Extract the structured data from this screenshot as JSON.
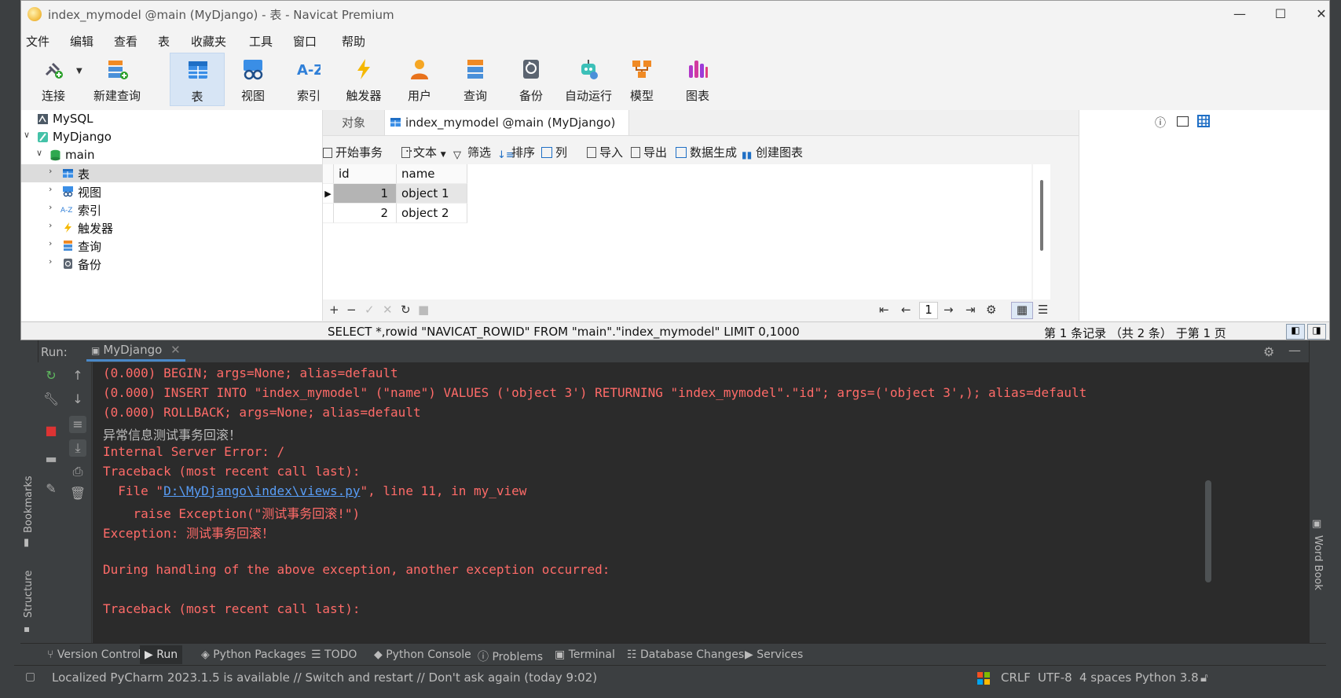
{
  "navicat": {
    "window_title": "index_mymodel @main (MyDjango) - 表 - Navicat Premium",
    "window_controls": {
      "minimize": "—",
      "maximize": "☐",
      "close": "✕"
    },
    "menu": [
      "文件",
      "编辑",
      "查看",
      "表",
      "收藏夹",
      "工具",
      "窗口",
      "帮助"
    ],
    "toolbar": [
      "连接",
      "新建查询",
      "表",
      "视图",
      "索引",
      "触发器",
      "用户",
      "查询",
      "备份",
      "自动运行",
      "模型",
      "图表"
    ],
    "toolbar_active": "表",
    "tree": {
      "conn1": "MySQL",
      "conn2": "MyDjango",
      "db": "main",
      "items": [
        "表",
        "视图",
        "索引",
        "触发器",
        "查询",
        "备份"
      ]
    },
    "tabs": {
      "objects": "对象",
      "active": "index_mymodel @main (MyDjango) ..."
    },
    "grid_toolbar": [
      "开始事务",
      "文本",
      "筛选",
      "排序",
      "列",
      "导入",
      "导出",
      "数据生成",
      "创建图表"
    ],
    "table": {
      "columns": [
        "id",
        "name"
      ],
      "rows": [
        [
          "1",
          "object 1"
        ],
        [
          "2",
          "object 2"
        ]
      ]
    },
    "pager": {
      "page": "1"
    },
    "sql": "SELECT *,rowid \"NAVICAT_ROWID\" FROM \"main\".\"index_mymodel\" LIMIT 0,1000",
    "record_info": "第 1 条记录 （共 2 条） 于第 1 页"
  },
  "pycharm": {
    "run_label": "Run:",
    "run_tab": "MyDjango",
    "left_strip": [
      "Bookmarks",
      "Structure"
    ],
    "right_strip": [
      "Word Book"
    ],
    "console": [
      {
        "text": "(0.000) BEGIN; args=None; alias=default",
        "kind": "err"
      },
      {
        "text": "(0.000) INSERT INTO \"index_mymodel\" (\"name\") VALUES ('object 3') RETURNING \"index_mymodel\".\"id\"; args=('object 3',); alias=default",
        "kind": "err"
      },
      {
        "text": "(0.000) ROLLBACK; args=None; alias=default",
        "kind": "err"
      },
      {
        "text": "异常信息测试事务回滚！",
        "kind": "out"
      },
      {
        "text": "Internal Server Error: /",
        "kind": "err"
      },
      {
        "text": "Traceback (most recent call last):",
        "kind": "err"
      },
      {
        "text": "  File \"",
        "kind": "err",
        "link": "D:\\MyDjango\\index\\views.py",
        "rest": "\", line 11, in my_view"
      },
      {
        "text": "    raise Exception(\"测试事务回滚!\")",
        "kind": "err"
      },
      {
        "text": "Exception: 测试事务回滚！",
        "kind": "err"
      },
      {
        "text": "",
        "kind": "err"
      },
      {
        "text": "During handling of the above exception, another exception occurred:",
        "kind": "err"
      },
      {
        "text": "",
        "kind": "err"
      },
      {
        "text": "Traceback (most recent call last):",
        "kind": "err"
      }
    ],
    "tool_windows": [
      "Version Control",
      "Run",
      "Python Packages",
      "TODO",
      "Python Console",
      "Problems",
      "Terminal",
      "Database Changes",
      "Services"
    ],
    "tool_active": "Run",
    "status_message": "Localized PyCharm 2023.1.5 is available // Switch and restart // Don't ask again (today 9:02)",
    "status_right": [
      "CRLF",
      "UTF-8",
      "4 spaces",
      "Python 3.8"
    ]
  }
}
